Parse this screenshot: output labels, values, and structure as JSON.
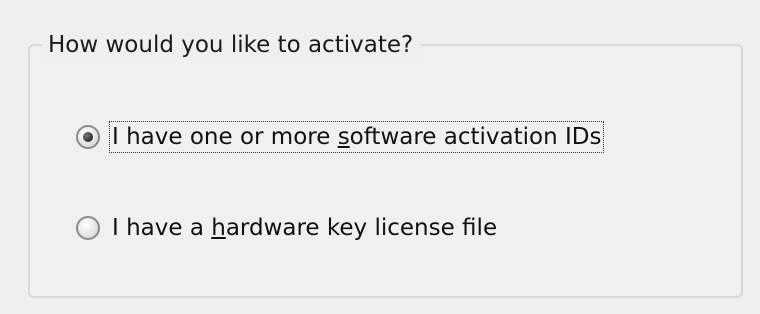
{
  "group": {
    "title": "How would you like to activate?"
  },
  "options": [
    {
      "pre": "I have one or more ",
      "mnemonic": "s",
      "post": "oftware activation IDs",
      "selected": true,
      "focused": true
    },
    {
      "pre": "I have a ",
      "mnemonic": "h",
      "post": "ardware key license file",
      "selected": false,
      "focused": false
    }
  ]
}
